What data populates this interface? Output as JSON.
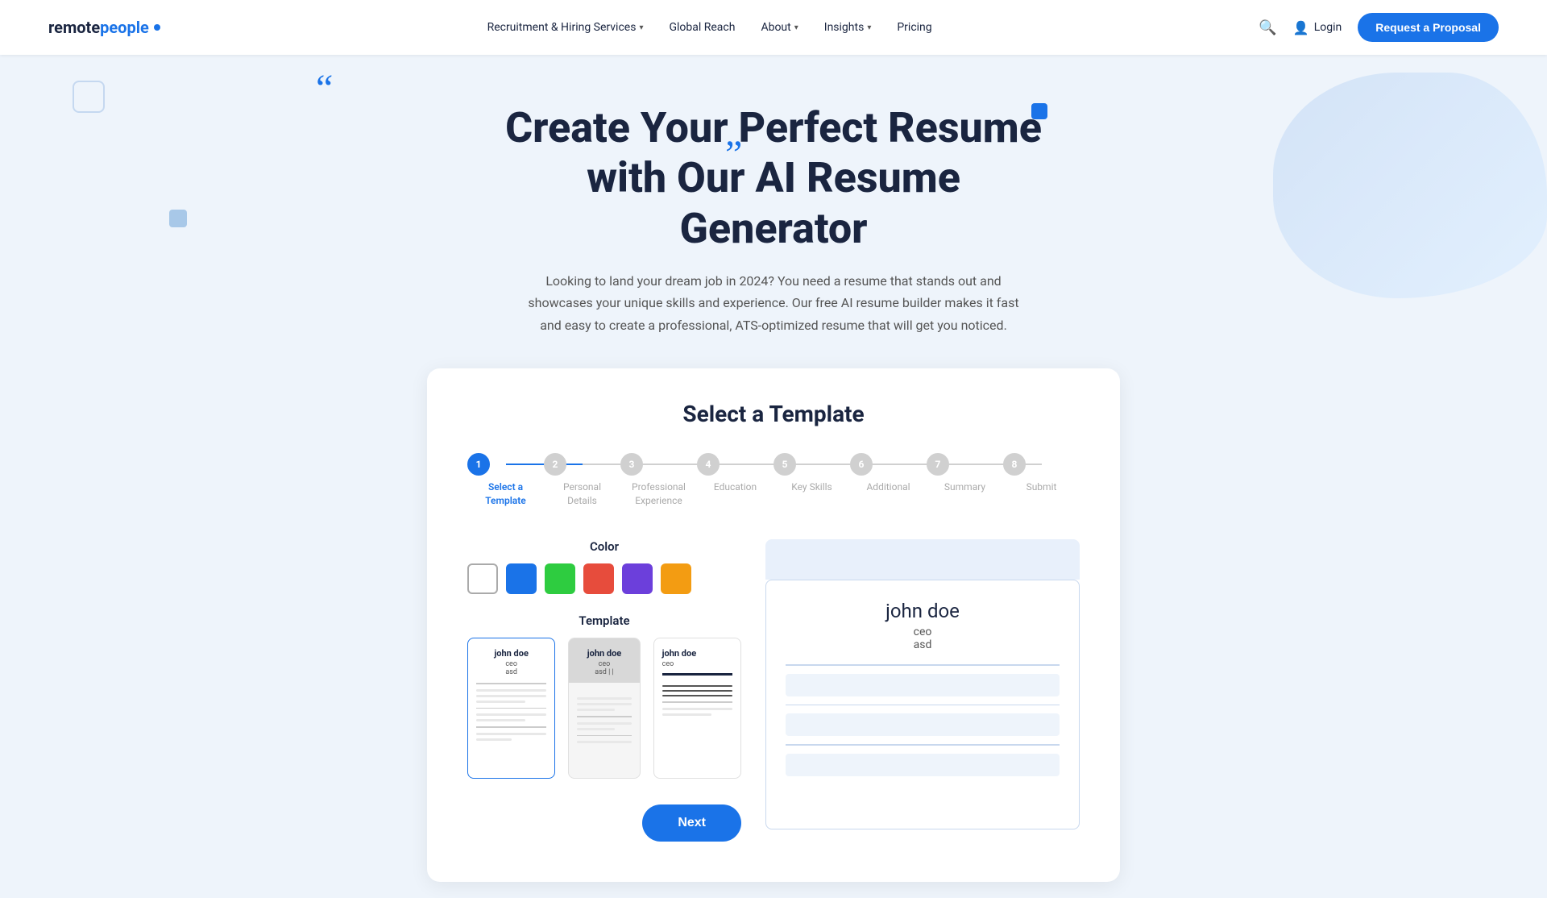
{
  "nav": {
    "logo_remote": "remote",
    "logo_people": "people",
    "links": [
      {
        "label": "Recruitment & Hiring Services",
        "has_dropdown": true
      },
      {
        "label": "Global Reach",
        "has_dropdown": false
      },
      {
        "label": "About",
        "has_dropdown": true
      },
      {
        "label": "Insights",
        "has_dropdown": true
      },
      {
        "label": "Pricing",
        "has_dropdown": false
      }
    ],
    "login_label": "Login",
    "cta_label": "Request a Proposal"
  },
  "hero": {
    "title": "Create Your Perfect Resume with Our AI Resume Generator",
    "subtitle": "Looking to land your dream job in 2024? You need a resume that stands out and showcases your unique skills and experience. Our free AI resume builder makes it fast and easy to create a professional, ATS-optimized resume that will get you noticed."
  },
  "card": {
    "title": "Select a Template",
    "stepper": {
      "steps": [
        {
          "number": "1",
          "label": "Select a\nTemplate",
          "active": true
        },
        {
          "number": "2",
          "label": "Personal\nDetails",
          "active": false
        },
        {
          "number": "3",
          "label": "Professional\nExperience",
          "active": false
        },
        {
          "number": "4",
          "label": "Education",
          "active": false
        },
        {
          "number": "5",
          "label": "Key Skills",
          "active": false
        },
        {
          "number": "6",
          "label": "Additional",
          "active": false
        },
        {
          "number": "7",
          "label": "Summary",
          "active": false
        },
        {
          "number": "8",
          "label": "Submit",
          "active": false
        }
      ]
    },
    "color_label": "Color",
    "colors": [
      {
        "value": "#ffffff",
        "selected": true
      },
      {
        "value": "#1a73e8"
      },
      {
        "value": "#2ecc40"
      },
      {
        "value": "#e74c3c"
      },
      {
        "value": "#6c3fdb"
      },
      {
        "value": "#f39c12"
      }
    ],
    "template_label": "Template",
    "templates": [
      {
        "name": "john doe",
        "role": "ceo",
        "company": "asd",
        "selected": true,
        "style": "classic"
      },
      {
        "name": "john doe",
        "role": "ceo",
        "company": "asd | |",
        "selected": false,
        "style": "modern"
      },
      {
        "name": "john doe",
        "role": "ceo",
        "company": "",
        "selected": false,
        "style": "minimal"
      }
    ],
    "preview": {
      "name": "john doe",
      "role": "ceo",
      "company": "asd"
    },
    "next_button_label": "Next"
  }
}
